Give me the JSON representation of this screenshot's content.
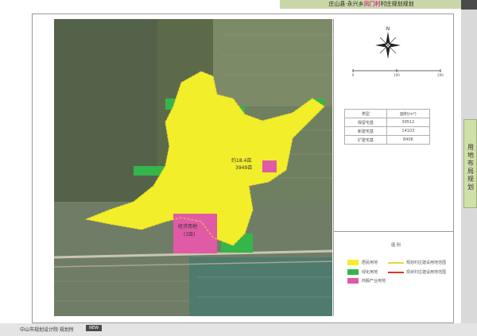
{
  "header": {
    "title_prefix": "庄山县·永兴乡",
    "title_highlight": "凤门村",
    "title_suffix": "村庄规划规划"
  },
  "side_tab": {
    "label": "用地布局规划"
  },
  "map": {
    "labels": {
      "label_a": "约18.4亩",
      "label_a2": "3949亩",
      "label_b": "经济用地",
      "label_b2": "(3亩)"
    }
  },
  "scale": {
    "ticks": [
      "0",
      "100",
      "200"
    ]
  },
  "stats_table": {
    "headers": [
      "类型",
      "面积(m²)"
    ],
    "rows": [
      [
        "保留宅基",
        "39512"
      ],
      [
        "新建宅基",
        "14103"
      ],
      [
        "扩建宅基",
        "8406"
      ]
    ]
  },
  "legend": {
    "title": "图  例",
    "items": {
      "yellow": "居民用地",
      "green": "绿化用地",
      "pink": "商服产业用地",
      "line_yellow": "规划村庄建设用地范围",
      "line_red": "现状村庄建设用地范围"
    },
    "colors": {
      "yellow": "#f2ee2a",
      "green": "#35b54a",
      "pink": "#e05aa6",
      "line_yellow": "#e6d63a",
      "line_red": "#d8332f"
    }
  },
  "footer": {
    "text": "中山市规划设计院·规划所",
    "badge": "NEW"
  }
}
